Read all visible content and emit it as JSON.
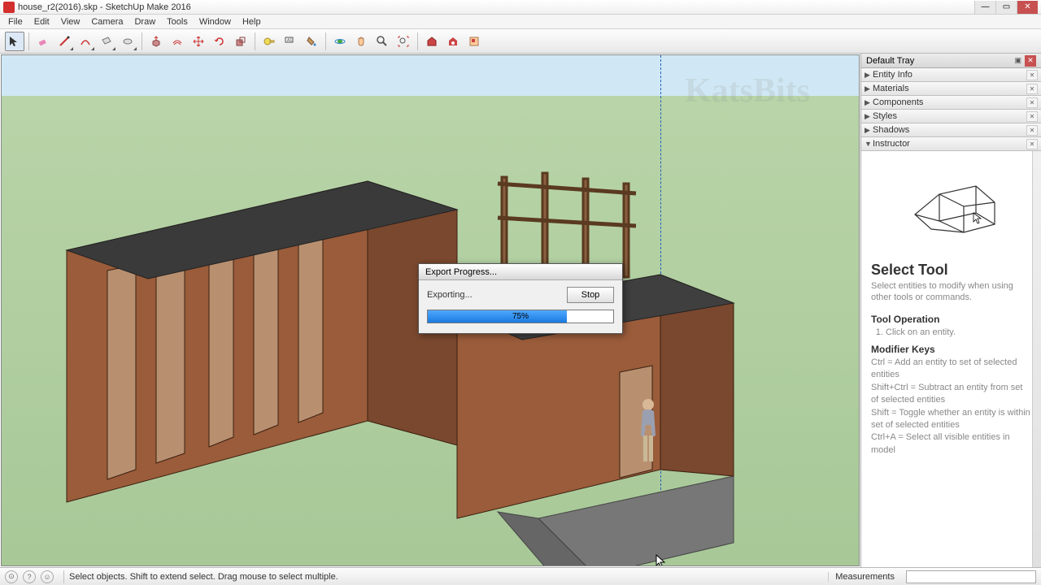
{
  "title": "house_r2(2016).skp - SketchUp Make 2016",
  "menu": [
    "File",
    "Edit",
    "View",
    "Camera",
    "Draw",
    "Tools",
    "Window",
    "Help"
  ],
  "watermark": "KatsBits",
  "tray": {
    "header": "Default Tray",
    "panels": [
      {
        "label": "Entity Info",
        "expanded": false
      },
      {
        "label": "Materials",
        "expanded": false
      },
      {
        "label": "Components",
        "expanded": false
      },
      {
        "label": "Styles",
        "expanded": false
      },
      {
        "label": "Shadows",
        "expanded": false
      },
      {
        "label": "Instructor",
        "expanded": true
      }
    ]
  },
  "instructor": {
    "title": "Select Tool",
    "subtitle": "Select entities to modify when using other tools or commands.",
    "operation_head": "Tool Operation",
    "operation_item": "Click on an entity.",
    "modifiers_head": "Modifier Keys",
    "modifiers": [
      "Ctrl = Add an entity to set of selected entities",
      "Shift+Ctrl = Subtract an entity from set of selected entities",
      "Shift = Toggle whether an entity is within set of selected entities",
      "Ctrl+A = Select all visible entities in model"
    ]
  },
  "dialog": {
    "title": "Export Progress...",
    "message": "Exporting...",
    "stop": "Stop",
    "percent": "75%",
    "fill_pct": 75
  },
  "status": {
    "hint": "Select objects. Shift to extend select. Drag mouse to select multiple.",
    "meas_label": "Measurements"
  }
}
